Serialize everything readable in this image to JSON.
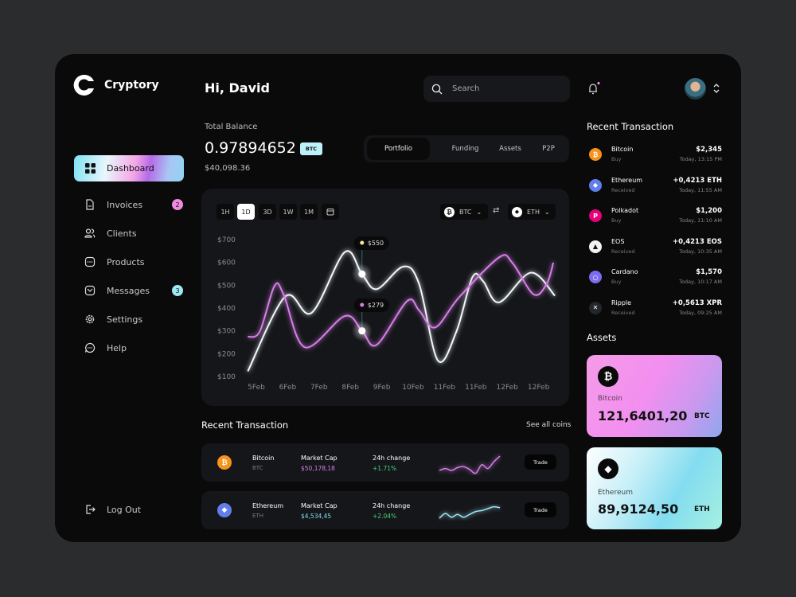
{
  "app": {
    "name": "Cryptory"
  },
  "sidebar": {
    "items": [
      {
        "label": "Dashboard",
        "icon": "grid-icon",
        "active": true
      },
      {
        "label": "Invoices",
        "icon": "document-icon",
        "badge": "2",
        "badge_color": "#f08ae0"
      },
      {
        "label": "Clients",
        "icon": "users-icon"
      },
      {
        "label": "Products",
        "icon": "box-dots-icon"
      },
      {
        "label": "Messages",
        "icon": "mail-icon",
        "badge": "3",
        "badge_color": "#9fe6f3"
      },
      {
        "label": "Settings",
        "icon": "gear-icon"
      },
      {
        "label": "Help",
        "icon": "chat-icon"
      }
    ],
    "logout": "Log Out"
  },
  "header": {
    "greeting": "Hi, David",
    "search_placeholder": "Search"
  },
  "balance": {
    "label": "Total Balance",
    "value": "0.97894652",
    "unit": "BTC",
    "fiat": "$40,098.36"
  },
  "tabs": [
    "Portfolio",
    "Funding",
    "Assets",
    "P2P"
  ],
  "chart_controls": {
    "ranges": [
      "1H",
      "1D",
      "3D",
      "1W",
      "1M"
    ],
    "active_range": "1D",
    "from": "BTC",
    "to": "ETH"
  },
  "chart_data": {
    "type": "line",
    "categories": [
      "5Feb",
      "6Feb",
      "7Feb",
      "8Feb",
      "9Feb",
      "10Feb",
      "11Feb",
      "11Feb",
      "12Feb",
      "12Feb"
    ],
    "yticks": [
      "$700",
      "$600",
      "$500",
      "$400",
      "$300",
      "$200",
      "$100"
    ],
    "ylim": [
      100,
      700
    ],
    "grid": false,
    "series": [
      {
        "color": "#f2f8fa",
        "points": [
          [
            -0.27,
            123
          ],
          [
            0.92,
            450
          ],
          [
            1.76,
            379
          ],
          [
            2.82,
            645
          ],
          [
            3.37,
            549
          ],
          [
            3.84,
            483
          ],
          [
            4.69,
            582
          ],
          [
            5.19,
            506
          ],
          [
            5.79,
            170
          ],
          [
            6.38,
            297
          ],
          [
            6.89,
            535
          ],
          [
            7.23,
            518
          ],
          [
            7.74,
            425
          ],
          [
            8.75,
            555
          ],
          [
            9.52,
            454
          ]
        ]
      },
      {
        "color": "#d77ee8",
        "points": [
          [
            -0.27,
            274
          ],
          [
            0.11,
            297
          ],
          [
            0.58,
            497
          ],
          [
            0.87,
            460
          ],
          [
            1.55,
            228
          ],
          [
            2.82,
            365
          ],
          [
            3.37,
            300
          ],
          [
            3.84,
            239
          ],
          [
            4.81,
            431
          ],
          [
            5.19,
            390
          ],
          [
            5.7,
            315
          ],
          [
            6.47,
            448
          ],
          [
            7.74,
            622
          ],
          [
            8.16,
            599
          ],
          [
            8.84,
            460
          ],
          [
            9.26,
            506
          ],
          [
            9.47,
            599
          ]
        ]
      }
    ],
    "annotations": [
      {
        "label": "$550",
        "x": 3.37,
        "y": 549,
        "dot": "#f6e7a6"
      },
      {
        "label": "$279",
        "x": 3.37,
        "y": 300,
        "dot": "#d77ee8"
      }
    ]
  },
  "recent": {
    "title": "Recent Transaction",
    "see_all": "See all coins",
    "columns": {
      "cap": "Market Cap",
      "change": "24h change"
    },
    "trade": "Trade",
    "rows": [
      {
        "name": "Bitcoin",
        "symbol": "BTC",
        "icon": "bitcoin-icon",
        "icon_color": "#f7931a",
        "cap": "$50,178,18",
        "cap_color": "#d77ee8",
        "change": "+1.71%",
        "spark_color": "#d77ee8",
        "spark": [
          3,
          2.6,
          3,
          2.4,
          2.2,
          2.8,
          3.6,
          1.8,
          2.6,
          1.2,
          0
        ]
      },
      {
        "name": "Ethereum",
        "symbol": "ETH",
        "icon": "ethereum-icon",
        "icon_color": "#627eea",
        "cap": "$4,534,45",
        "cap_color": "#7fdcf0",
        "change": "+2.04%",
        "spark_color": "#9fe6f3",
        "spark": [
          3,
          2,
          2.8,
          2.2,
          2.8,
          2.2,
          1.6,
          1.4,
          1,
          0.6,
          0.8
        ]
      }
    ]
  },
  "side_transactions": {
    "title": "Recent Transaction",
    "items": [
      {
        "name": "Bitcoin",
        "type": "Buy",
        "amount": "$2,345",
        "time": "Today, 13:15 PM",
        "icon": "bitcoin-icon",
        "color": "#f7931a",
        "glyph": "₿"
      },
      {
        "name": "Ethereum",
        "type": "Received",
        "amount": "+0,4213 ETH",
        "time": "Today, 11:55 AM",
        "icon": "ethereum-icon",
        "color": "#627eea",
        "glyph": "◆"
      },
      {
        "name": "Polkadot",
        "type": "Buy",
        "amount": "$1,200",
        "time": "Today, 11:10 AM",
        "icon": "polkadot-icon",
        "color": "#e6007a",
        "glyph": "P"
      },
      {
        "name": "EOS",
        "type": "Received",
        "amount": "+0,4213 EOS",
        "time": "Today, 10:35 AM",
        "icon": "eos-icon",
        "color": "#f2f2f2",
        "glyph": "▲"
      },
      {
        "name": "Cardano",
        "type": "Buy",
        "amount": "$1,570",
        "time": "Today, 10:17 AM",
        "icon": "cardano-icon",
        "color": "#7b6cf0",
        "glyph": "○"
      },
      {
        "name": "Ripple",
        "type": "Received",
        "amount": "+0,5613 XPR",
        "time": "Today, 09:25 AM",
        "icon": "ripple-icon",
        "color": "#23262b",
        "glyph": "✕"
      }
    ]
  },
  "assets": {
    "title": "Assets",
    "cards": [
      {
        "name": "Bitcoin",
        "value": "121,6401,20",
        "unit": "BTC",
        "icon": "bitcoin-icon"
      },
      {
        "name": "Ethereum",
        "value": "89,9124,50",
        "unit": "ETH",
        "icon": "ethereum-icon"
      }
    ]
  }
}
